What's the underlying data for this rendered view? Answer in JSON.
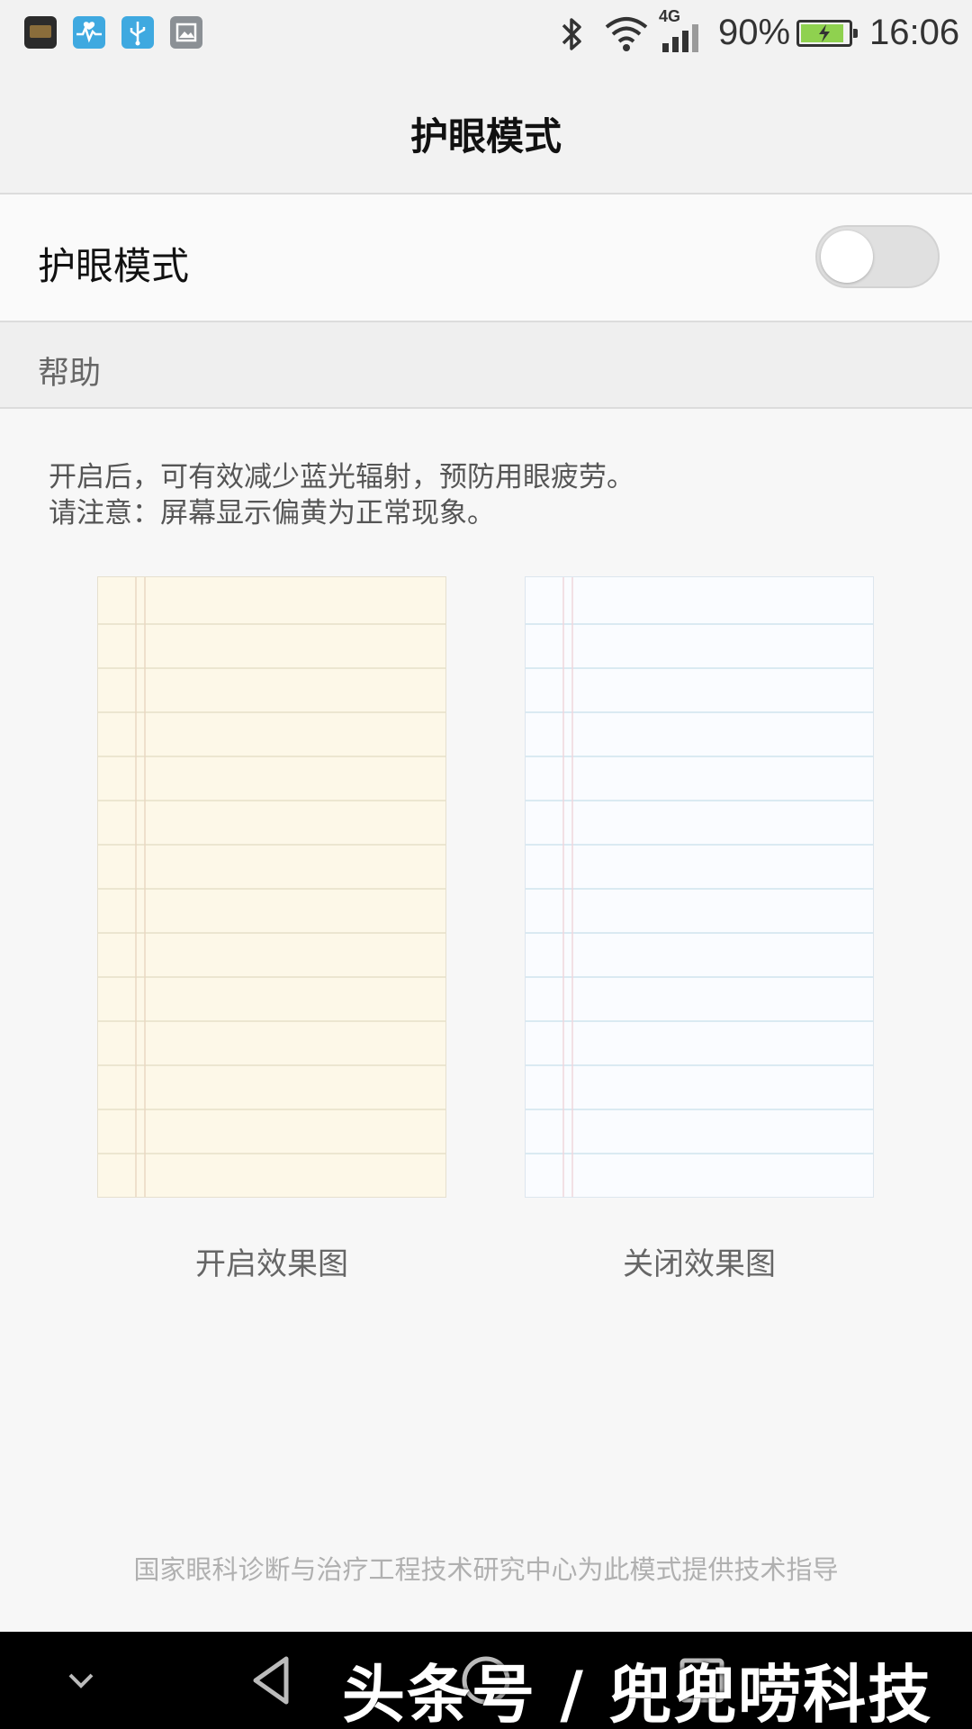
{
  "status_bar": {
    "notification_icons": [
      "game-app-icon",
      "health-app-icon",
      "usb-icon",
      "gallery-icon"
    ],
    "system_icons": [
      "bluetooth-icon",
      "wifi-icon",
      "cellular-signal-icon",
      "battery-icon"
    ],
    "network_type": "4G",
    "battery_percent": "90%",
    "battery_level": 0.9,
    "time": "16:06"
  },
  "header": {
    "title": "护眼模式"
  },
  "eye_mode_setting": {
    "label": "护眼模式",
    "enabled": false
  },
  "help": {
    "section_label": "帮助",
    "description_line1": "开启后，可有效减少蓝光辐射，预防用眼疲劳。",
    "description_line2": "请注意：屏幕显示偏黄为正常现象。"
  },
  "previews": [
    {
      "caption": "开启效果图",
      "paper_color": "#fdf8e8",
      "line_color": "#e6dfc7",
      "margin_color": "#ead7c2"
    },
    {
      "caption": "关闭效果图",
      "paper_color": "#fafcff",
      "line_color": "#cfe3ee",
      "margin_color": "#f0d6dc"
    }
  ],
  "footer": {
    "note": "国家眼科诊断与治疗工程技术研究中心为此模式提供技术指导"
  },
  "nav_bar": {
    "buttons": [
      "collapse-chevron-icon",
      "back-triangle-icon",
      "home-circle-icon",
      "recents-square-icon"
    ],
    "watermark": "头条号 / 兜兜唠科技"
  },
  "colors": {
    "accent_battery": "#8fd14f",
    "background": "#f7f7f7",
    "nav_bar": "#000000"
  }
}
